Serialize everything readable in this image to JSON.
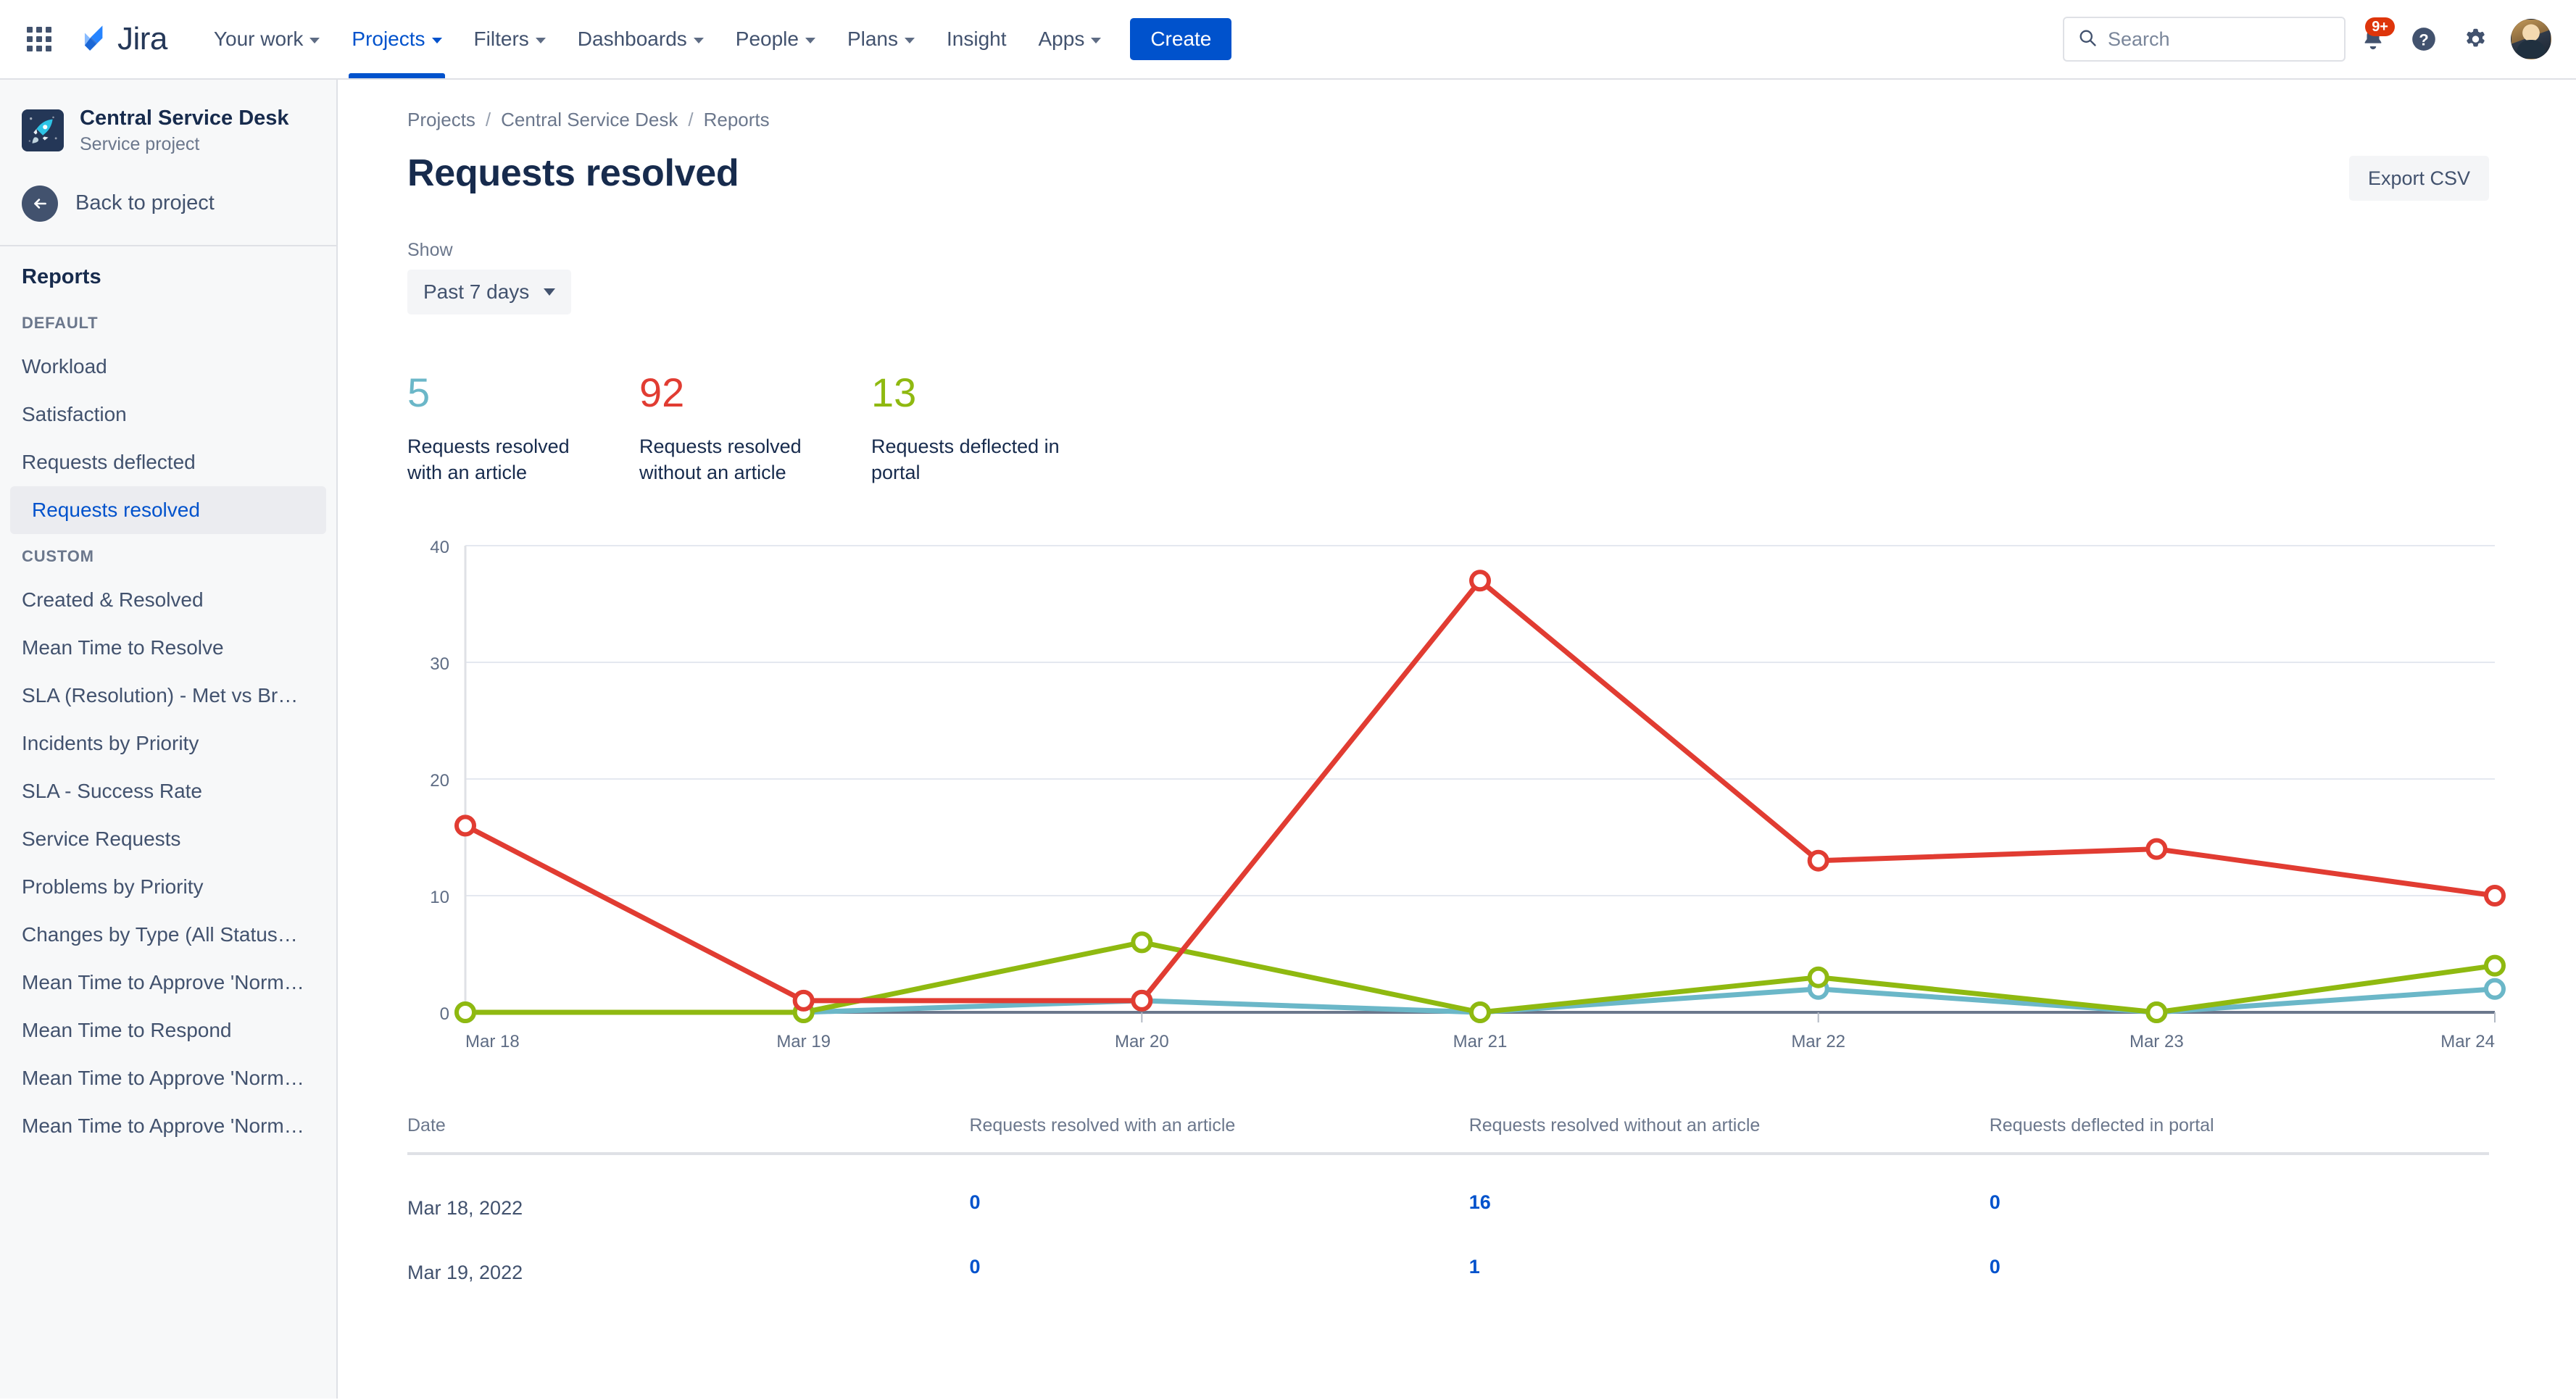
{
  "topnav": {
    "app_switcher_icon": "grid-apps-icon",
    "logo_text": "Jira",
    "items": [
      {
        "label": "Your work",
        "has_chevron": true,
        "active": false
      },
      {
        "label": "Projects",
        "has_chevron": true,
        "active": true
      },
      {
        "label": "Filters",
        "has_chevron": true,
        "active": false
      },
      {
        "label": "Dashboards",
        "has_chevron": true,
        "active": false
      },
      {
        "label": "People",
        "has_chevron": true,
        "active": false
      },
      {
        "label": "Plans",
        "has_chevron": true,
        "active": false
      },
      {
        "label": "Insight",
        "has_chevron": false,
        "active": false
      },
      {
        "label": "Apps",
        "has_chevron": true,
        "active": false
      }
    ],
    "create_label": "Create",
    "search": {
      "placeholder": "Search",
      "value": ""
    },
    "notifications_badge": "9+",
    "icons": [
      "notification-bell-icon",
      "help-icon",
      "settings-gear-icon",
      "user-avatar"
    ]
  },
  "sidebar": {
    "project_name": "Central Service Desk",
    "project_type": "Service project",
    "project_icon": "rocket-icon",
    "back_label": "Back to project",
    "section_title": "Reports",
    "groups": [
      {
        "heading": "DEFAULT",
        "items": [
          {
            "label": "Workload",
            "selected": false
          },
          {
            "label": "Satisfaction",
            "selected": false
          },
          {
            "label": "Requests deflected",
            "selected": false
          },
          {
            "label": "Requests resolved",
            "selected": true
          }
        ]
      },
      {
        "heading": "CUSTOM",
        "items": [
          {
            "label": "Created & Resolved",
            "selected": false
          },
          {
            "label": "Mean Time to Resolve",
            "selected": false
          },
          {
            "label": "SLA (Resolution) - Met vs Bre…",
            "selected": false
          },
          {
            "label": "Incidents by Priority",
            "selected": false
          },
          {
            "label": "SLA - Success Rate",
            "selected": false
          },
          {
            "label": "Service Requests",
            "selected": false
          },
          {
            "label": "Problems by Priority",
            "selected": false
          },
          {
            "label": "Changes by Type (All Statuses)",
            "selected": false
          },
          {
            "label": "Mean Time to Approve 'Norm…",
            "selected": false
          },
          {
            "label": "Mean Time to Respond",
            "selected": false
          },
          {
            "label": "Mean Time to Approve 'Norm…",
            "selected": false
          },
          {
            "label": "Mean Time to Approve 'Norm…",
            "selected": false
          }
        ]
      }
    ]
  },
  "main": {
    "breadcrumb": [
      "Projects",
      "Central Service Desk",
      "Reports"
    ],
    "breadcrumb_separator": "/",
    "page_title": "Requests resolved",
    "export_label": "Export CSV",
    "show_label": "Show",
    "period_value": "Past 7 days",
    "stats": [
      {
        "value": "5",
        "label": "Requests resolved with an article",
        "color": "#6BB7C8"
      },
      {
        "value": "92",
        "label": "Requests resolved without an article",
        "color": "#E13C32"
      },
      {
        "value": "13",
        "label": "Requests deflected in portal",
        "color": "#8FB910"
      }
    ]
  },
  "chart_data": {
    "type": "line",
    "title": "",
    "xlabel": "",
    "ylabel": "",
    "x": [
      "Mar 18",
      "Mar 19",
      "Mar 20",
      "Mar 21",
      "Mar 22",
      "Mar 23",
      "Mar 24"
    ],
    "ylim": [
      0,
      40
    ],
    "yticks": [
      0,
      10,
      20,
      30,
      40
    ],
    "grid": true,
    "legend": "none",
    "series": [
      {
        "name": "Requests resolved without an article",
        "color": "#E13C32",
        "values": [
          16,
          1,
          1,
          37,
          13,
          14,
          10
        ]
      },
      {
        "name": "Requests deflected in portal",
        "color": "#8FB910",
        "values": [
          0,
          0,
          6,
          0,
          3,
          0,
          4
        ]
      },
      {
        "name": "Requests resolved with an article",
        "color": "#6BB7C8",
        "values": [
          0,
          0,
          1,
          0,
          2,
          0,
          2
        ]
      }
    ]
  },
  "table": {
    "columns": [
      "Date",
      "Requests resolved with an article",
      "Requests resolved without an article",
      "Requests deflected in portal"
    ],
    "rows": [
      {
        "date": "Mar 18, 2022",
        "with_article": "0",
        "without_article": "16",
        "deflected": "0"
      },
      {
        "date": "Mar 19, 2022",
        "with_article": "0",
        "without_article": "1",
        "deflected": "0"
      }
    ]
  }
}
